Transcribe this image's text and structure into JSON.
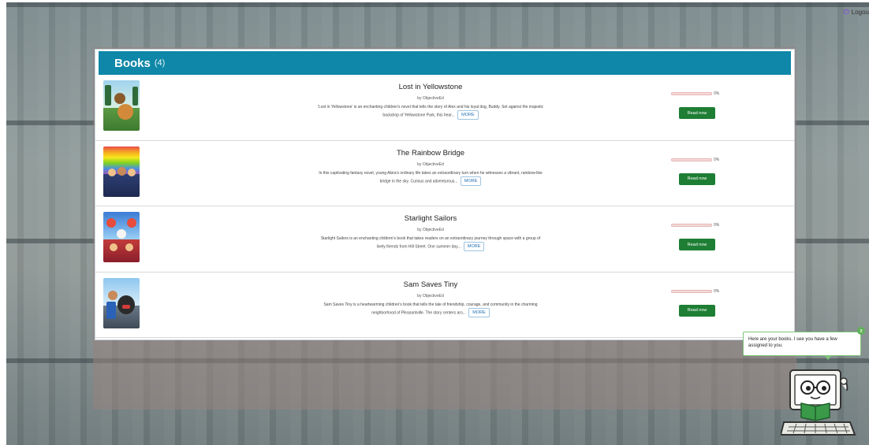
{
  "header": {
    "logout_label": "Logou",
    "logout_icon": "power-icon"
  },
  "panel": {
    "title": "Books",
    "count": "(4)",
    "accent_color": "#0e87a8"
  },
  "books": [
    {
      "title": "Lost in Yellowstone",
      "author": "by ObjectiveEd",
      "description": "'Lost in Yellowstone' is an enchanting children's novel that tells the story of Alex and his loyal dog, Buddy. Set against the majestic backdrop of Yellowstone Park, this hear...",
      "more_label": "MORE",
      "progress_label": "0%",
      "progress_value": 0,
      "read_label": "Read now"
    },
    {
      "title": "The Rainbow Bridge",
      "author": "by ObjectiveEd",
      "description": "In this captivating fantasy novel, young Akira's ordinary life takes an extraordinary turn when he witnesses a vibrant, rainbow-like bridge in the sky. Curious and adventurous...",
      "more_label": "MORE",
      "progress_label": "0%",
      "progress_value": 0,
      "read_label": "Read now"
    },
    {
      "title": "Starlight Sailors",
      "author": "by ObjectiveEd",
      "description": "Starlight Sailors is an enchanting children's book that takes readers on an extraordinary journey through space with a group of lively friends from Hill Street. One summer day...",
      "more_label": "MORE",
      "progress_label": "0%",
      "progress_value": 0,
      "read_label": "Read now"
    },
    {
      "title": "Sam Saves Tiny",
      "author": "by ObjectiveEd",
      "description": "Sam Saves Tiny is a heartwarming children's book that tells the tale of friendship, courage, and community in the charming neighborhood of Pleasantville. The story centers aro...",
      "more_label": "MORE",
      "progress_label": "0%",
      "progress_value": 0,
      "read_label": "Read now"
    }
  ],
  "assistant": {
    "message": "Here are your books. I see you have a few assigned to you.",
    "close_label": "x",
    "mascot_icon": "book-reading-computer-mascot-icon"
  },
  "colors": {
    "read_button": "#1e7e34",
    "more_button_text": "#1f6fb3",
    "progress_bar": "#e57373",
    "bubble_border": "#7fc37a"
  }
}
